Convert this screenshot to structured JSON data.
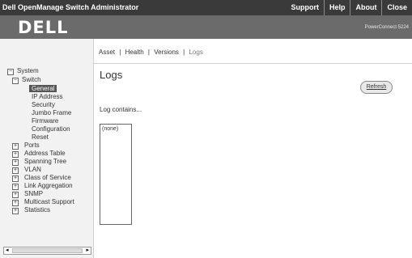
{
  "app": {
    "title": "Dell OpenManage Switch Administrator",
    "menu": [
      "Support",
      "Help",
      "About",
      "Close"
    ],
    "logo": "DELL",
    "model": "PowerConnect 5224"
  },
  "tabs": [
    "Asset",
    "|",
    "Health",
    "|",
    "Versions",
    "|",
    "Logs"
  ],
  "page": {
    "title": "Logs",
    "refresh": "Refresh",
    "logs_label": "Log contains...",
    "log_items": [
      "(none)"
    ]
  },
  "tree": {
    "system": "System",
    "switch": "Switch",
    "switch_children": [
      "General",
      "IP Address",
      "Security",
      "Jumbo Frame",
      "Firmware",
      "Configuration",
      "Reset"
    ],
    "others": [
      "Ports",
      "Address Table",
      "Spanning Tree",
      "VLAN",
      "Class of Service",
      "Link Aggregation",
      "SNMP",
      "Multicast Support",
      "Statistics"
    ],
    "expand_plus": "+",
    "collapse_minus": "−"
  }
}
